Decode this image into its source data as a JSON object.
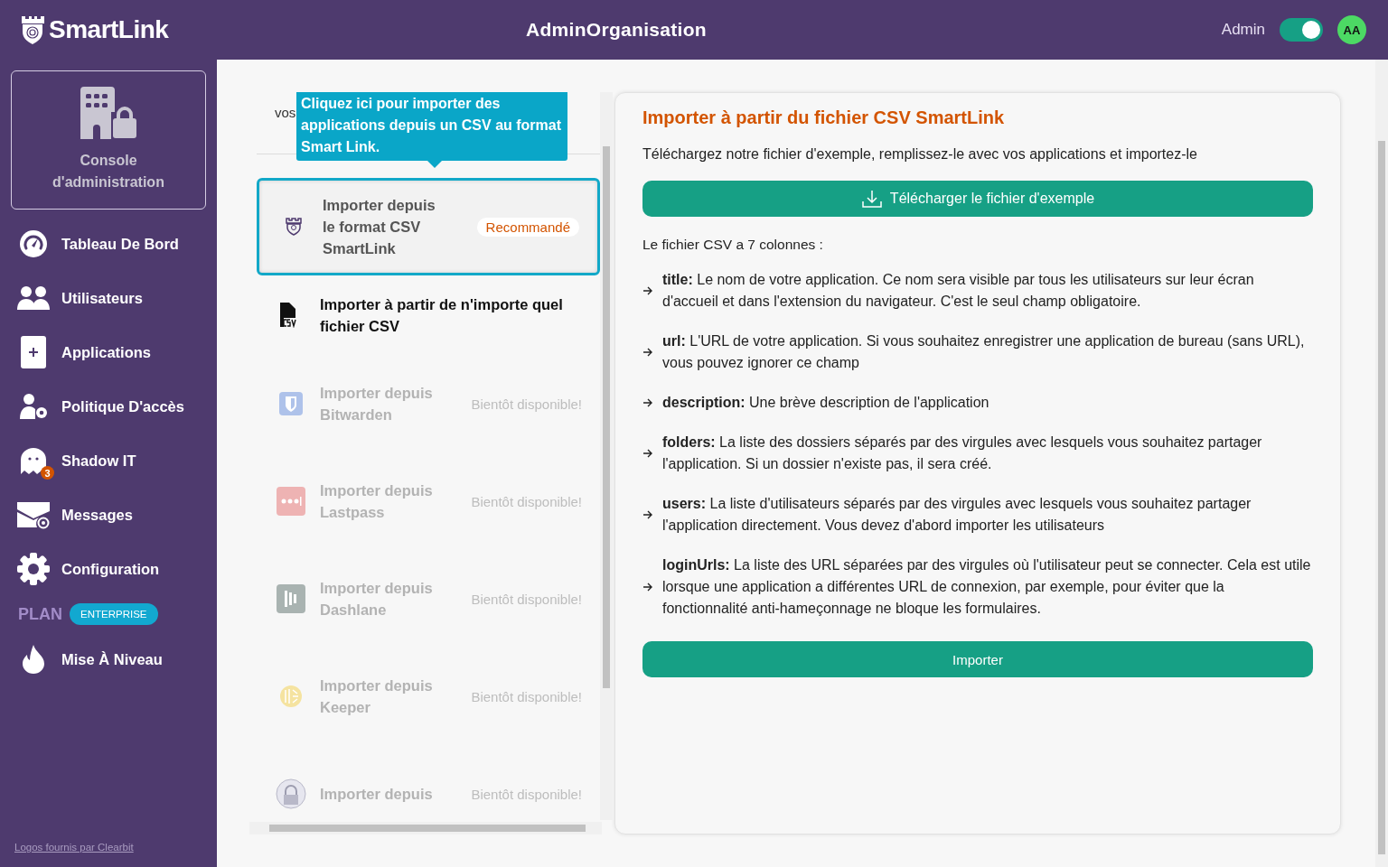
{
  "header": {
    "brand": "SmartLink",
    "title": "AdminOrganisation",
    "role": "Admin",
    "admin_toggle": {
      "on": true
    },
    "avatar": "AA"
  },
  "sidebar": {
    "console": "Console d'administration",
    "items": [
      {
        "label": "Tableau De Bord"
      },
      {
        "label": "Utilisateurs"
      },
      {
        "label": "Applications"
      },
      {
        "label": "Politique D'accès"
      },
      {
        "label": "Shadow IT",
        "badge": "3"
      },
      {
        "label": "Messages"
      },
      {
        "label": "Configuration"
      }
    ],
    "plan_label": "PLAN",
    "plan_badge": "ENTERPRISE",
    "upgrade": "Mise À Niveau",
    "footer_link": "Logos fournis par Clearbit"
  },
  "import_panel": {
    "intro_fragment": "vos",
    "tooltip": "Cliquez ici pour importer des applications depuis un CSV au format Smart Link.",
    "options": [
      {
        "kind": "recommended",
        "title": "Importer depuis le format CSV SmartLink",
        "tag": "Recommandé",
        "selected": true,
        "disabled": false
      },
      {
        "kind": "csv",
        "title": "Importer à partir de n'importe quel fichier CSV",
        "selected": false,
        "disabled": false
      },
      {
        "kind": "soon",
        "title": "Importer depuis Bitwarden",
        "tag": "Bientôt disponible!",
        "selected": false,
        "disabled": true
      },
      {
        "kind": "soon",
        "title": "Importer depuis Lastpass",
        "tag": "Bientôt disponible!",
        "selected": false,
        "disabled": true
      },
      {
        "kind": "soon",
        "title": "Importer depuis Dashlane",
        "tag": "Bientôt disponible!",
        "selected": false,
        "disabled": true
      },
      {
        "kind": "soon",
        "title": "Importer depuis Keeper",
        "tag": "Bientôt disponible!",
        "selected": false,
        "disabled": true
      },
      {
        "kind": "soon",
        "title": "Importer depuis",
        "tag": "Bientôt disponible!",
        "selected": false,
        "disabled": true
      }
    ]
  },
  "detail": {
    "title": "Importer à partir du fichier CSV SmartLink",
    "subtitle": "Téléchargez notre fichier d'exemple, remplissez-le avec vos applications et importez-le",
    "download_button": "Télécharger le fichier d'exemple",
    "columns_intro": "Le fichier CSV a 7 colonnes :",
    "columns": [
      "**title:** Le nom de votre application. Ce nom sera visible par tous les utilisateurs sur leur écran d'accueil et dans l'extension du navigateur. C'est le seul champ obligatoire.",
      "**url:** L'URL de votre application. Si vous souhaitez enregistrer une application de bureau (sans URL), vous pouvez ignorer ce champ",
      "**description:** Une brève description de l'application",
      "**folders:** La liste des dossiers séparés par des virgules avec lesquels vous souhaitez partager l'application. Si un dossier n'existe pas, il sera créé.",
      "**users:** La liste d'utilisateurs séparés par des virgules avec lesquels vous souhaitez partager l'application directement. Vous devez d'abord importer les utilisateurs",
      "**loginUrls:** La liste des URL séparées par des virgules où l'utilisateur peut se connecter. Cela est utile lorsque une application a différentes URL de connexion, par exemple, pour éviter que la fonctionnalité anti-hameçonnage ne bloque les formulaires."
    ],
    "import_button": "Importer"
  }
}
